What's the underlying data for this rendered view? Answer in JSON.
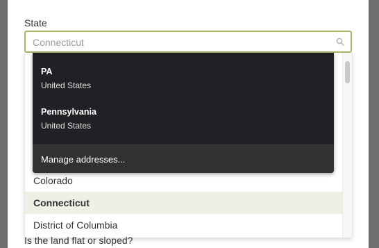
{
  "form": {
    "state_label": "State",
    "state_placeholder": "Connecticut",
    "next_question": "Is the land flat or sloped?"
  },
  "state_options": [
    {
      "label": "Colorado",
      "selected": false
    },
    {
      "label": "Connecticut",
      "selected": true
    },
    {
      "label": "District of Columbia",
      "selected": false
    }
  ],
  "autofill": {
    "suggestions": [
      {
        "title": "PA",
        "subtitle": "United States"
      },
      {
        "title": "Pennsylvania",
        "subtitle": "United States"
      }
    ],
    "manage_label": "Manage addresses..."
  },
  "colors": {
    "input_border": "#a8b56a",
    "selected_bg": "#eef0e6",
    "autofill_bg": "#202124",
    "overlay": "#6f6f6f"
  },
  "icons": {
    "search": "search-icon"
  }
}
